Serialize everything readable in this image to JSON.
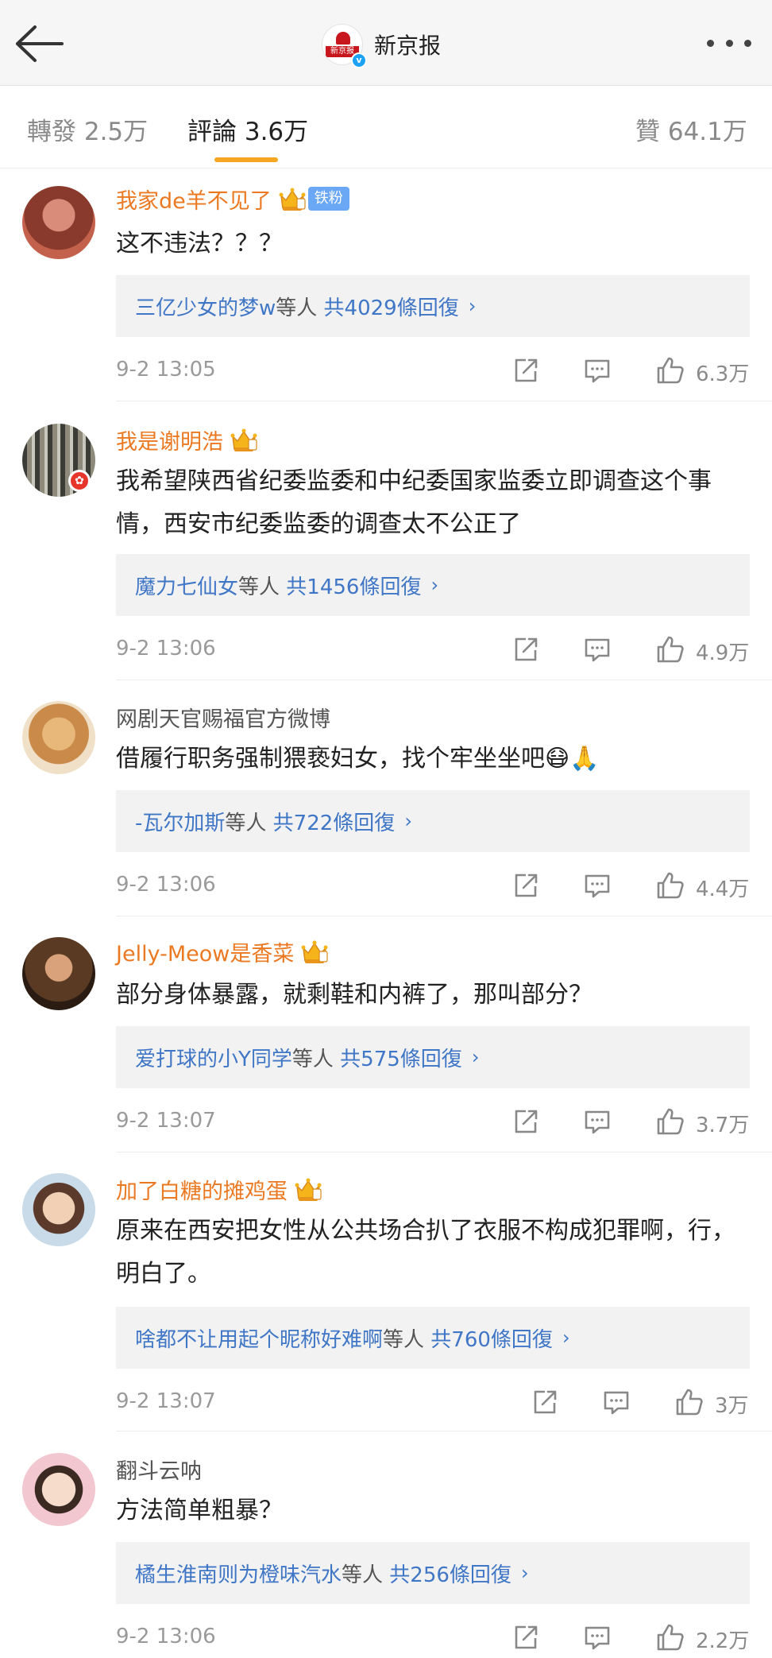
{
  "header": {
    "title": "新京报",
    "logo_text": "新京报",
    "back_icon": "back-arrow-icon",
    "more_icon": "more-horizontal-icon"
  },
  "tabs": [
    {
      "label": "轉發",
      "count": "2.5万"
    },
    {
      "label": "評論",
      "count": "3.6万"
    },
    {
      "label": "贊",
      "count": "64.1万"
    }
  ],
  "accent_color": "#f6a623",
  "username_color": "#eb7922",
  "link_color": "#3f76c6",
  "comments": [
    {
      "username": "我家de羊不见了",
      "fan_badge": "铁粉",
      "text": "这不违法？？？",
      "reply_from": "三亿少女的梦w",
      "reply_etc": "等人",
      "reply_count": "共4029條回復",
      "time": "9-2 13:05",
      "likes": "6.3万"
    },
    {
      "username": "我是谢明浩",
      "text": "我希望陕西省纪委监委和中纪委国家监委立即调查这个事情，西安市纪委监委的调查太不公正了",
      "reply_from": "魔力七仙女",
      "reply_etc": "等人",
      "reply_count": "共1456條回復",
      "time": "9-2 13:06",
      "likes": "4.9万"
    },
    {
      "username": "网剧天官赐福官方微博",
      "text": "借履行职务强制猥亵妇女，找个牢坐坐吧😷🙏",
      "reply_from": "-瓦尔加斯",
      "reply_etc": "等人",
      "reply_count": "共722條回復",
      "time": "9-2 13:06",
      "likes": "4.4万"
    },
    {
      "username": "Jelly-Meow是香菜",
      "text": "部分身体暴露，就剩鞋和内裤了，那叫部分？",
      "reply_from": "爱打球的小Y同学",
      "reply_etc": "等人",
      "reply_count": "共575條回復",
      "time": "9-2 13:07",
      "likes": "3.7万"
    },
    {
      "username": "加了白糖的摊鸡蛋",
      "text": "原来在西安把女性从公共场合扒了衣服不构成犯罪啊，行，明白了。",
      "reply_from": "啥都不让用起个昵称好难啊",
      "reply_etc": "等人",
      "reply_count": "共760條回復",
      "time": "9-2 13:07",
      "likes": "3万"
    },
    {
      "username": "翻斗云呐",
      "text": "方法简单粗暴？",
      "reply_from": "橘生淮南则为橙味汽水",
      "reply_etc": "等人",
      "reply_count": "共256條回復",
      "time": "9-2 13:06",
      "likes": "2.2万"
    }
  ]
}
